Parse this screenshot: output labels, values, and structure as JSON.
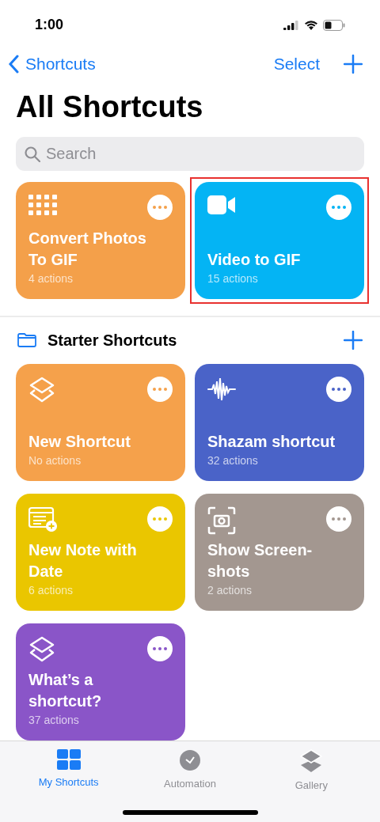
{
  "status_bar": {
    "time": "1:00"
  },
  "nav": {
    "back": "Shortcuts",
    "select": "Select"
  },
  "title": "All Shortcuts",
  "search": {
    "placeholder": "Search"
  },
  "shortcuts": [
    {
      "kind": "grid",
      "title": "Convert Photos To GIF",
      "subtitle": "4 actions",
      "color": "#f4a04a",
      "highlighted": false
    },
    {
      "kind": "video",
      "title": "Video to GIF",
      "subtitle": "15 actions",
      "color": "#04b4f4",
      "highlighted": true
    }
  ],
  "folder": {
    "title": "Starter Shortcuts",
    "shortcuts": [
      {
        "kind": "layers",
        "title": "New Shortcut",
        "subtitle": "No actions",
        "color": "#f5a14b",
        "highlighted": false
      },
      {
        "kind": "waveform",
        "title": "Shazam shortcut",
        "subtitle": "32 actions",
        "color": "#4a63c8",
        "highlighted": false
      },
      {
        "kind": "note",
        "title": "New Note with Date",
        "subtitle": "6 actions",
        "color": "#eac600",
        "highlighted": false
      },
      {
        "kind": "camera",
        "title": "Show Screen-shots",
        "subtitle": "2 actions",
        "color": "#a39790",
        "highlighted": false
      },
      {
        "kind": "layers",
        "title": "What’s a shortcut?",
        "subtitle": "37 actions",
        "color": "#8a55c8",
        "highlighted": false
      }
    ]
  },
  "tabs": [
    {
      "kind": "grid",
      "label": "My Shortcuts",
      "selected": true
    },
    {
      "kind": "clock",
      "label": "Automation",
      "selected": false
    },
    {
      "kind": "stack",
      "label": "Gallery",
      "selected": false
    }
  ]
}
